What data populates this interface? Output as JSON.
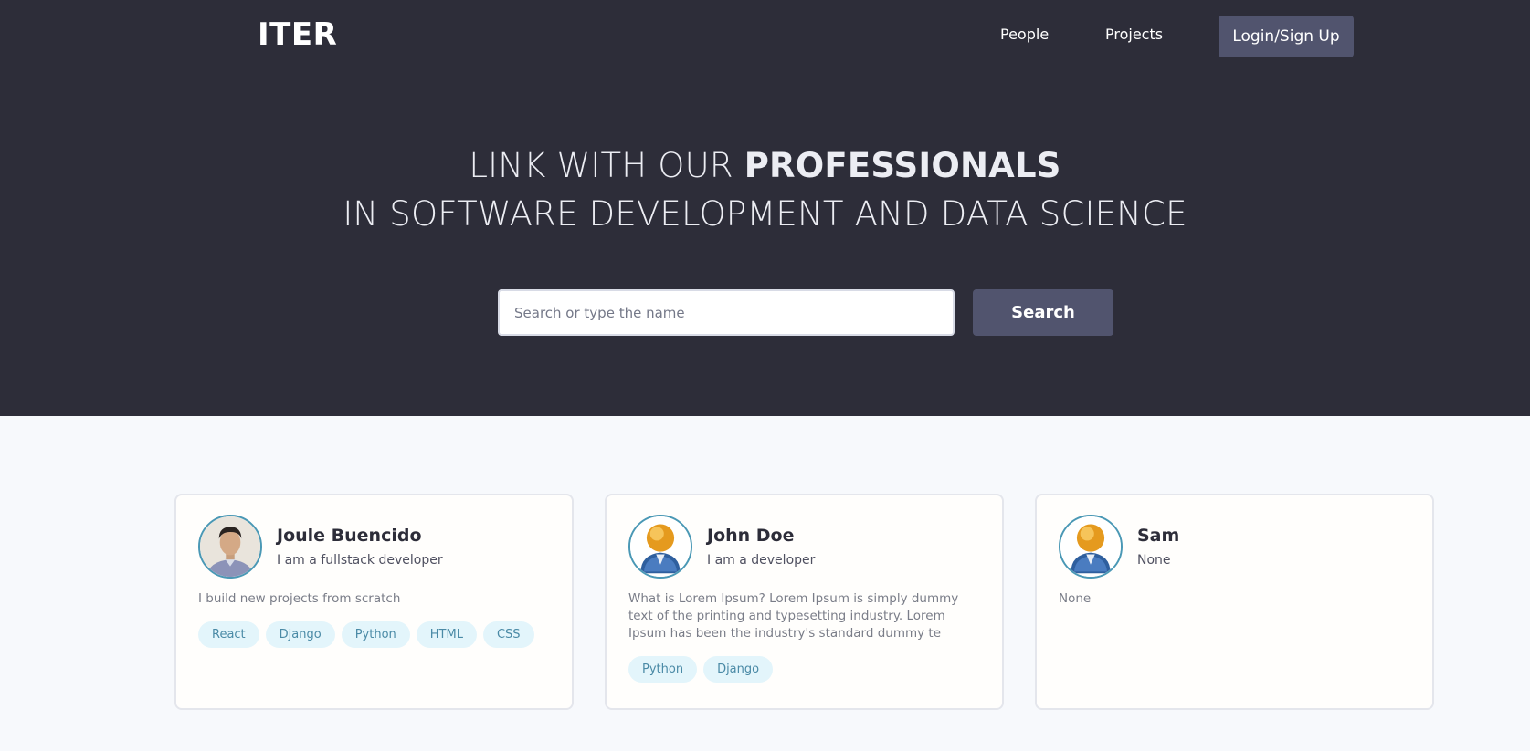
{
  "nav": {
    "logo": "ITER",
    "people": "People",
    "projects": "Projects",
    "login": "Login/Sign Up"
  },
  "hero": {
    "line1_prefix": "LINK WITH OUR ",
    "line1_bold": "PROFESSIONALS",
    "line2": "IN SOFTWARE DEVELOPMENT AND DATA SCIENCE"
  },
  "search": {
    "placeholder": "Search or type the name",
    "button": "Search"
  },
  "colors": {
    "header_bg": "#2d2d39",
    "button_bg": "#51546e",
    "tag_bg": "#e3f5fb",
    "tag_text": "#4a8aa6",
    "avatar_border": "#4a98b5"
  },
  "profiles": [
    {
      "name": "Joule Buencido",
      "title": "I am a fullstack developer",
      "bio": "I build new projects from scratch",
      "avatar": "person-photo",
      "tags": [
        "React",
        "Django",
        "Python",
        "HTML",
        "CSS"
      ]
    },
    {
      "name": "John Doe",
      "title": "I am a developer",
      "bio": "What is Lorem Ipsum? Lorem Ipsum is simply dummy text of the printing and typesetting industry. Lorem Ipsum has been the industry's standard dummy te",
      "avatar": "default-user-icon",
      "tags": [
        "Python",
        "Django"
      ]
    },
    {
      "name": "Sam",
      "title": "None",
      "bio": "None",
      "avatar": "default-user-icon",
      "tags": []
    }
  ]
}
